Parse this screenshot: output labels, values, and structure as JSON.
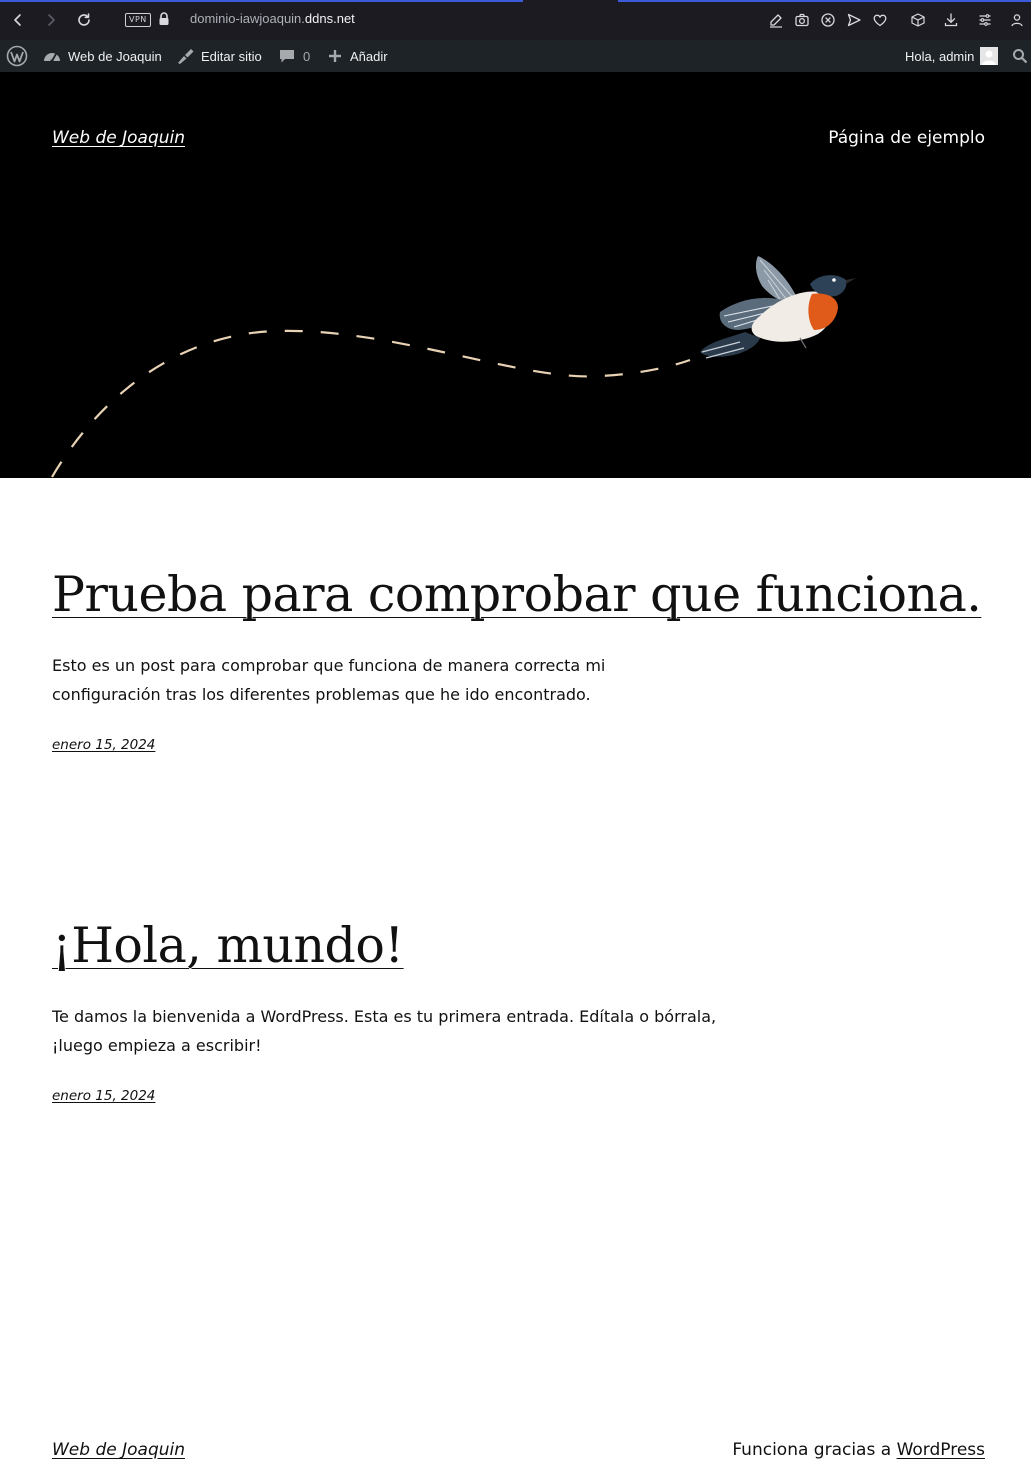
{
  "browser": {
    "vpn_label": "VPN",
    "url_domain_prefix": "dominio-iawjoaquin.",
    "url_domain_main": "ddns.net",
    "icons": [
      "back-icon",
      "forward-icon",
      "reload-icon",
      "vpn-badge",
      "lock-icon",
      "edit-icon",
      "camera-icon",
      "close-circle-icon",
      "send-icon",
      "heart-icon",
      "cube-icon",
      "download-icon",
      "menu-icon",
      "profile-icon"
    ]
  },
  "admin_bar": {
    "site_name": "Web de Joaquin",
    "edit_site": "Editar sitio",
    "comments_count": "0",
    "add_new": "Añadir",
    "greeting": "Hola, admin"
  },
  "header": {
    "site_title": "Web de Joaquin",
    "nav_link": "Página de ejemplo"
  },
  "posts": [
    {
      "title": "Prueba para comprobar que funciona.",
      "excerpt": "Esto es un post para comprobar que funciona de manera correcta mi configuración tras los diferentes problemas que he ido encontrado.",
      "date": "enero 15, 2024"
    },
    {
      "title": "¡Hola, mundo!",
      "excerpt": "Te damos la bienvenida a WordPress. Esta es tu primera entrada. Edítala o bórrala, ¡luego empieza a escribir!",
      "date": "enero 15, 2024"
    }
  ],
  "footer": {
    "site_title": "Web de Joaquin",
    "credit_prefix": "Funciona gracias a ",
    "credit_link": "WordPress"
  },
  "colors": {
    "browser_bar": "#1b1b21",
    "admin_bar": "#1d2327",
    "hero_bg": "#000000",
    "dashed_path": "#e8d2b4",
    "bird_breast": "#e05a1a"
  }
}
